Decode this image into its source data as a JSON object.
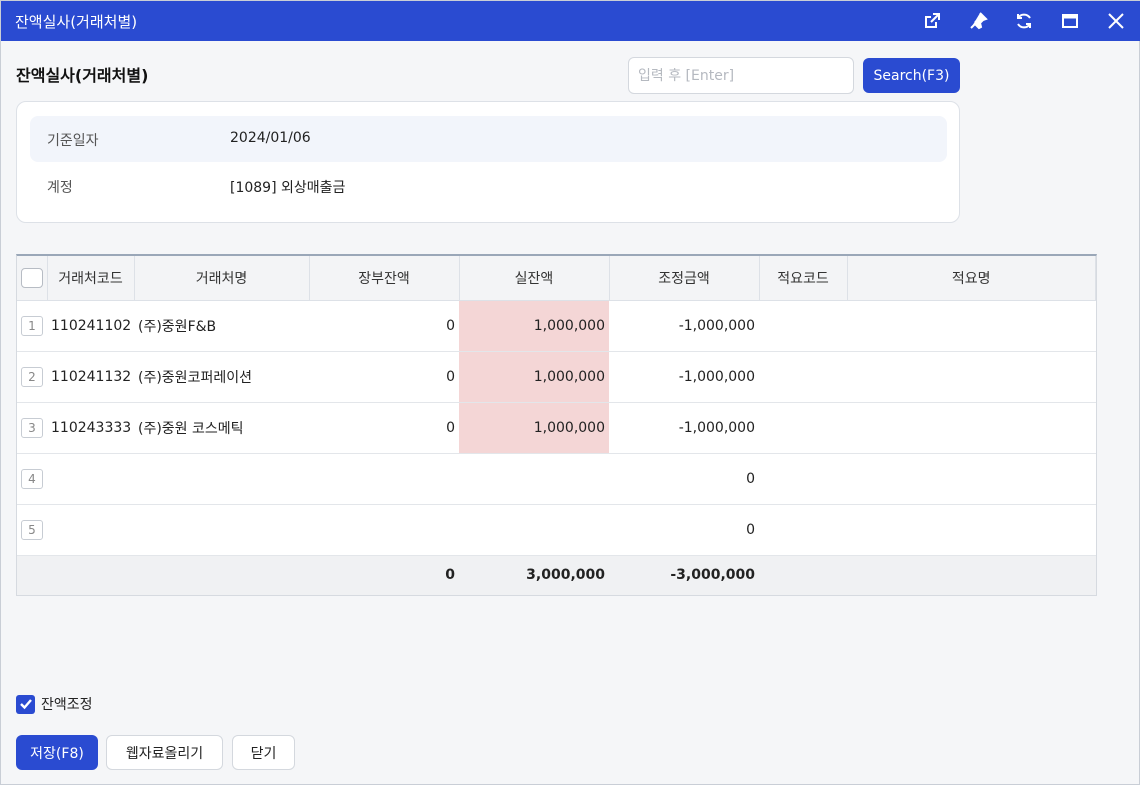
{
  "window": {
    "title": "잔액실사(거래처별)"
  },
  "page": {
    "title": "잔액실사(거래처별)"
  },
  "search": {
    "placeholder": "입력 후 [Enter]",
    "button_label": "Search(F3)"
  },
  "info": {
    "base_date_label": "기준일자",
    "base_date_value": "2024/01/06",
    "account_label": "계정",
    "account_value": "[1089] 외상매출금"
  },
  "grid": {
    "headers": {
      "code": "거래처코드",
      "name": "거래처명",
      "book_balance": "장부잔액",
      "actual_balance": "실잔액",
      "adjust_amount": "조정금액",
      "memo_code": "적요코드",
      "memo_name": "적요명"
    },
    "rows": [
      {
        "num": "1",
        "code": "110241102",
        "name": "(주)중원F&B",
        "book": "0",
        "actual": "1,000,000",
        "adjust": "-1,000,000",
        "memo_code": "",
        "memo_name": ""
      },
      {
        "num": "2",
        "code": "110241132",
        "name": "(주)중원코퍼레이션",
        "book": "0",
        "actual": "1,000,000",
        "adjust": "-1,000,000",
        "memo_code": "",
        "memo_name": ""
      },
      {
        "num": "3",
        "code": "110243333",
        "name": "(주)중원 코스메틱",
        "book": "0",
        "actual": "1,000,000",
        "adjust": "-1,000,000",
        "memo_code": "",
        "memo_name": ""
      },
      {
        "num": "4",
        "code": "",
        "name": "",
        "book": "",
        "actual": "",
        "adjust": "0",
        "memo_code": "",
        "memo_name": ""
      },
      {
        "num": "5",
        "code": "",
        "name": "",
        "book": "",
        "actual": "",
        "adjust": "0",
        "memo_code": "",
        "memo_name": ""
      }
    ],
    "totals": {
      "book": "0",
      "actual": "3,000,000",
      "adjust": "-3,000,000"
    }
  },
  "footer": {
    "adjust_checkbox_label": "잔액조정",
    "save_label": "저장(F8)",
    "upload_label": "웹자료올리기",
    "close_label": "닫기"
  }
}
